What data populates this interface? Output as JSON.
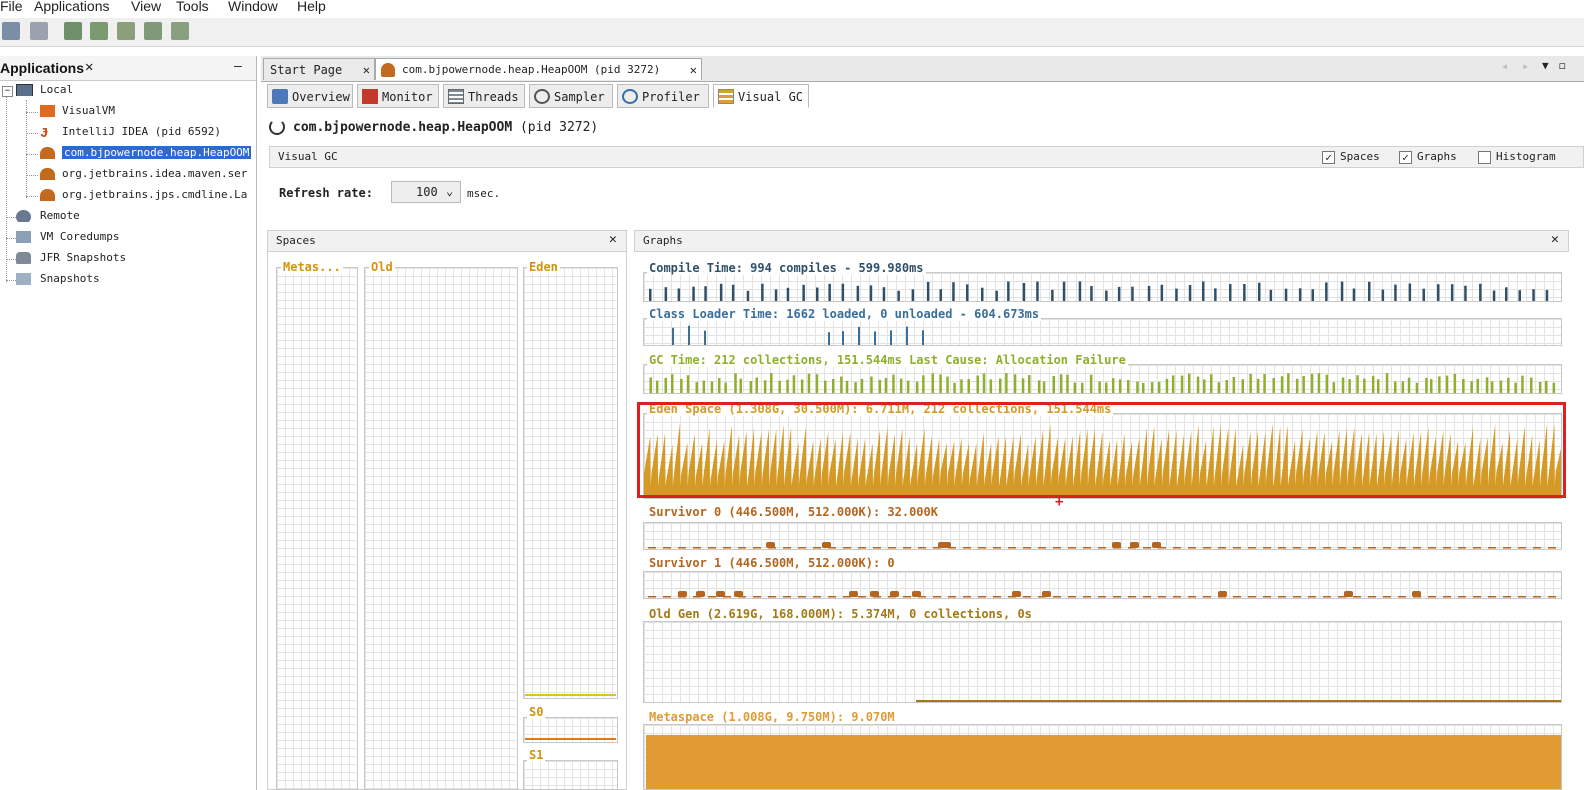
{
  "menubar": {
    "items": [
      "File",
      "Applications",
      "View",
      "Tools",
      "Window",
      "Help"
    ]
  },
  "applications": {
    "title": "Applications",
    "close": "✕",
    "minimize": "—",
    "tree": [
      {
        "label": "Local",
        "level": 0,
        "icon": "computer-icon"
      },
      {
        "label": "VisualVM",
        "level": 1,
        "icon": "visualvm-icon"
      },
      {
        "label": "IntelliJ IDEA (pid 6592)",
        "level": 1,
        "icon": "intellij-icon"
      },
      {
        "label": "com.bjpowernode.heap.HeapOOM",
        "level": 1,
        "icon": "java-app-icon",
        "selected": true
      },
      {
        "label": "org.jetbrains.idea.maven.ser",
        "level": 1,
        "icon": "java-app-icon"
      },
      {
        "label": "org.jetbrains.jps.cmdline.La",
        "level": 1,
        "icon": "java-app-icon"
      },
      {
        "label": "Remote",
        "level": 0,
        "icon": "remote-icon"
      },
      {
        "label": "VM Coredumps",
        "level": 0,
        "icon": "coredump-icon"
      },
      {
        "label": "JFR Snapshots",
        "level": 0,
        "icon": "jfr-icon"
      },
      {
        "label": "Snapshots",
        "level": 0,
        "icon": "snapshot-icon"
      }
    ]
  },
  "tabs": {
    "start": "Start Page",
    "app": "com.bjpowernode.heap.HeapOOM (pid 3272)",
    "close": "✕"
  },
  "subtabs": [
    "Overview",
    "Monitor",
    "Threads",
    "Sampler",
    "Profiler",
    "Visual GC"
  ],
  "app_header": {
    "name": "com.bjpowernode.heap.HeapOOM",
    "pid": "(pid 3272)"
  },
  "visual_gc": {
    "title": "Visual GC",
    "options": [
      {
        "label": "Spaces",
        "checked": true
      },
      {
        "label": "Graphs",
        "checked": true
      },
      {
        "label": "Histogram",
        "checked": false
      }
    ],
    "refresh_label": "Refresh rate:",
    "refresh_value": "100",
    "refresh_unit": "msec."
  },
  "spaces": {
    "title": "Spaces",
    "close": "✕",
    "columns": {
      "metaspace": "Metas...",
      "old": "Old",
      "eden": "Eden",
      "s0": "S0",
      "s1": "S1"
    }
  },
  "graphs": {
    "title": "Graphs",
    "close": "✕",
    "items": [
      {
        "label": "Compile Time: 994 compiles - 599.980ms",
        "color": "#30506a"
      },
      {
        "label": "Class Loader Time: 1662 loaded, 0 unloaded - 604.673ms",
        "color": "#3a6e9a"
      },
      {
        "label": "GC Time: 212 collections, 151.544ms Last Cause: Allocation Failure",
        "color": "#8fb02c"
      },
      {
        "label": "Eden Space (1.308G, 30.500M): 6.711M, 212 collections, 151.544ms",
        "color": "#d49a25"
      },
      {
        "label": "Survivor 0 (446.500M, 512.000K): 32.000K",
        "color": "#b5651d"
      },
      {
        "label": "Survivor 1 (446.500M, 512.000K): 0",
        "color": "#b5651d"
      },
      {
        "label": "Old Gen (2.619G, 168.000M): 5.374M, 0 collections, 0s",
        "color": "#a07a18"
      },
      {
        "label": "Metaspace (1.008G, 9.750M): 9.070M",
        "color": "#e09b35"
      }
    ]
  },
  "colors": {
    "eden": "#d49a25",
    "gc": "#8fb02c",
    "compile": "#30506a",
    "highlight": "#e02020",
    "selection": "#2a6ad5"
  }
}
